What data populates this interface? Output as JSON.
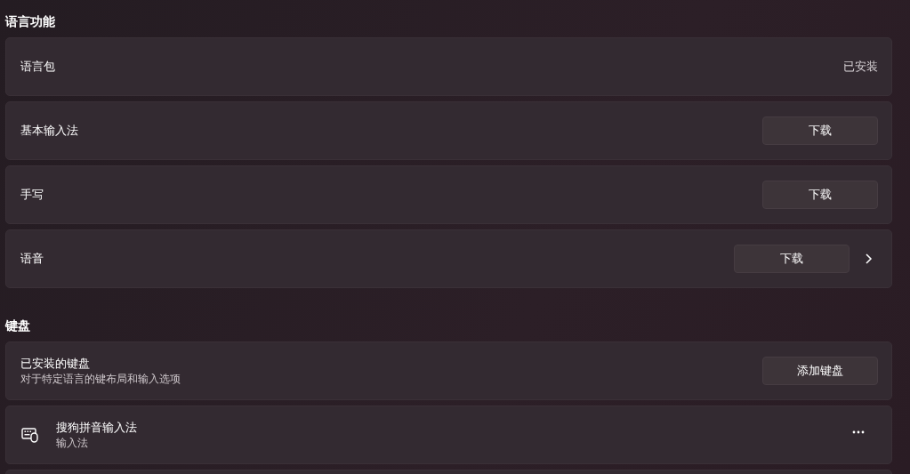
{
  "sections": [
    {
      "title": "语言功能",
      "items": [
        {
          "kind": "status",
          "label": "语言包",
          "status": "已安装"
        },
        {
          "kind": "button",
          "label": "基本输入法",
          "button": "下载"
        },
        {
          "kind": "button",
          "label": "手写",
          "button": "下载"
        },
        {
          "kind": "link",
          "label": "语音",
          "button": "下载"
        }
      ]
    },
    {
      "title": "键盘",
      "items": [
        {
          "kind": "button",
          "label": "已安装的键盘",
          "description": "对于特定语言的键布局和输入选项",
          "button": "添加键盘"
        },
        {
          "kind": "app",
          "label": "搜狗拼音输入法",
          "description": "输入法"
        }
      ]
    }
  ]
}
